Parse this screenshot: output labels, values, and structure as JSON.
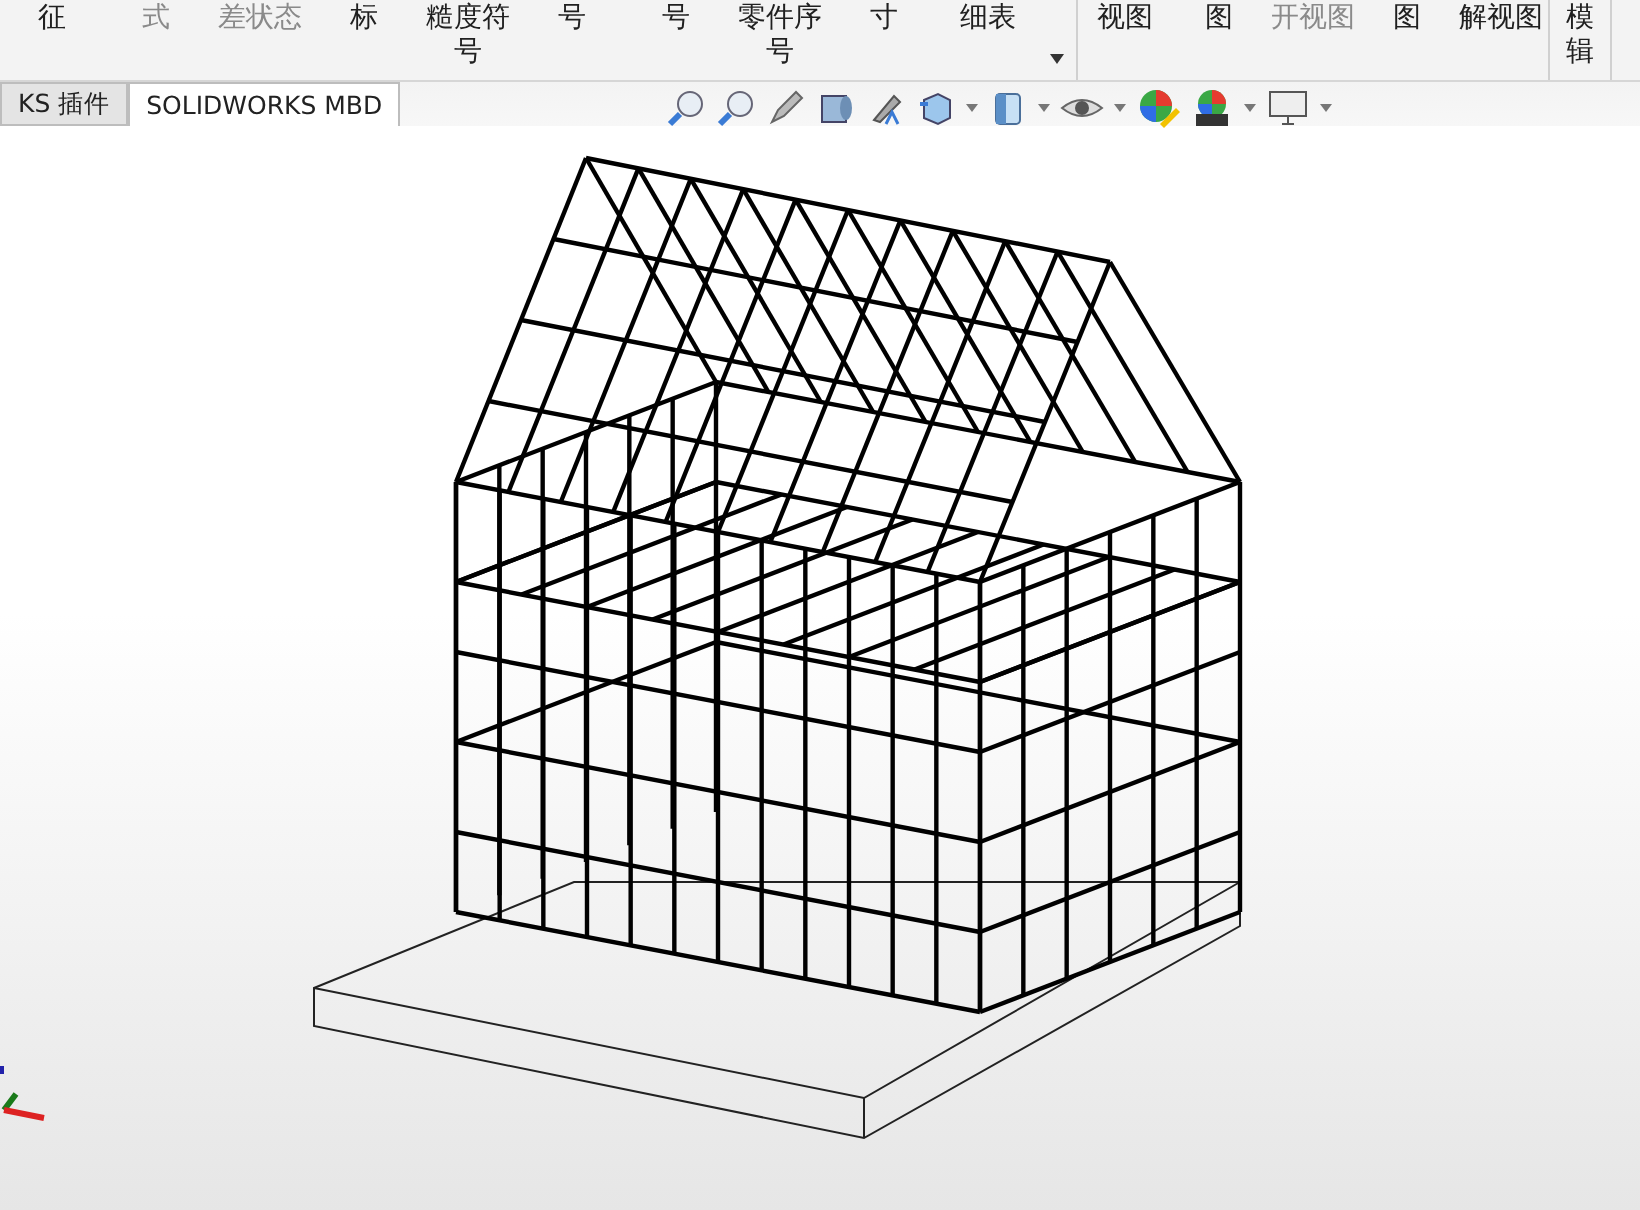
{
  "ribbon": {
    "groups": [
      {
        "buttons": [
          {
            "lines": [
              "征"
            ],
            "disabled": false
          },
          {
            "lines": [
              "式"
            ],
            "disabled": true
          },
          {
            "lines": [
              "差状态"
            ],
            "disabled": true
          },
          {
            "lines": [
              "标"
            ],
            "disabled": false
          },
          {
            "lines": [
              "糙度符",
              "号"
            ],
            "disabled": false
          },
          {
            "lines": [
              "号"
            ],
            "disabled": false
          },
          {
            "lines": [
              "号"
            ],
            "disabled": false
          },
          {
            "lines": [
              "零件序",
              "号"
            ],
            "disabled": false
          },
          {
            "lines": [
              "寸"
            ],
            "disabled": false
          },
          {
            "lines": [
              "细表"
            ],
            "disabled": false
          }
        ],
        "overflow": true
      },
      {
        "buttons": [
          {
            "lines": [
              "视图"
            ],
            "disabled": false
          },
          {
            "lines": [
              "图"
            ],
            "disabled": false
          },
          {
            "lines": [
              "开视图"
            ],
            "disabled": true
          },
          {
            "lines": [
              "图"
            ],
            "disabled": false
          },
          {
            "lines": [
              "解视图"
            ],
            "disabled": false
          }
        ],
        "overflow": false
      },
      {
        "buttons": [
          {
            "lines": [
              "模",
              "辑"
            ],
            "disabled": false
          }
        ],
        "overflow": false
      }
    ]
  },
  "tabs": [
    {
      "label": "KS 插件",
      "selected": false
    },
    {
      "label": "SOLIDWORKS MBD",
      "selected": true
    }
  ]
}
